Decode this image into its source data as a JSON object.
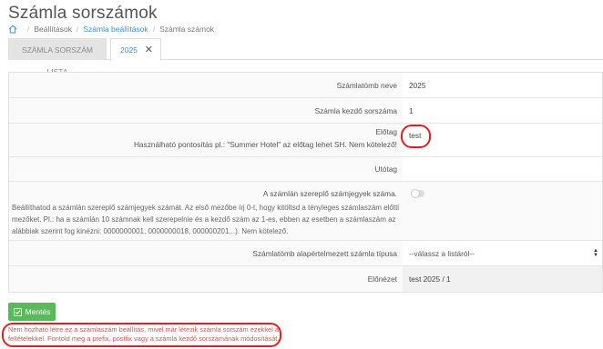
{
  "page": {
    "title": "Számla sorszámok"
  },
  "breadcrumb": {
    "items": [
      "Beállítások",
      "Számla beállítások",
      "Számla számok"
    ]
  },
  "tabs": [
    {
      "label": "SZÁMLA SORSZÁM LISTA"
    },
    {
      "label": "2025"
    }
  ],
  "form": {
    "name_label": "Számlatömb neve",
    "name_value": "2025",
    "start_label": "Számla kezdő sorszáma",
    "start_value": "1",
    "prefix_label": "Előtag",
    "prefix_help": "Használható pontosítás pl.: \"Summer Hotel\" az előtag lehet SH. Nem kötelező!",
    "prefix_value": "test",
    "suffix_label": "Utótag",
    "suffix_value": "",
    "digits_label": "A számlán szereplő számjegyek száma.",
    "digits_help": "Beállíthatod a számlán szereplő számjegyek számát. Az első mezőbe írj 0-t, hogy kitöltsd a tényleges számlaszám előtti mezőket. Pl.: ha a számlán 10 számnak kell szerepelnie és a kezdő szám az 1-es, ebben az esetben a számlaszám az alábbiak szerint fog kinézni: 0000000001, 0000000018, 000000201...). Nem kötelező.",
    "type_label": "Számlatömb alapértelmezett számla típusa",
    "type_value": "--válassz a listáról--",
    "preview_label": "Előnézet",
    "preview_value": "test 2025 / 1"
  },
  "actions": {
    "save_label": "Mentés"
  },
  "error": {
    "message": "Nem hozható létre ez a számlaszám beállítás, mivel már létezik számla sorszám ezekkel a feltételekkel. Fontold meg a prefix, postfix vagy a számla kezdő sorszámának módosítását."
  },
  "colors": {
    "accent": "#3b8fd0",
    "success": "#5cb85c",
    "error": "#d9534f",
    "highlight": "#e02020"
  }
}
